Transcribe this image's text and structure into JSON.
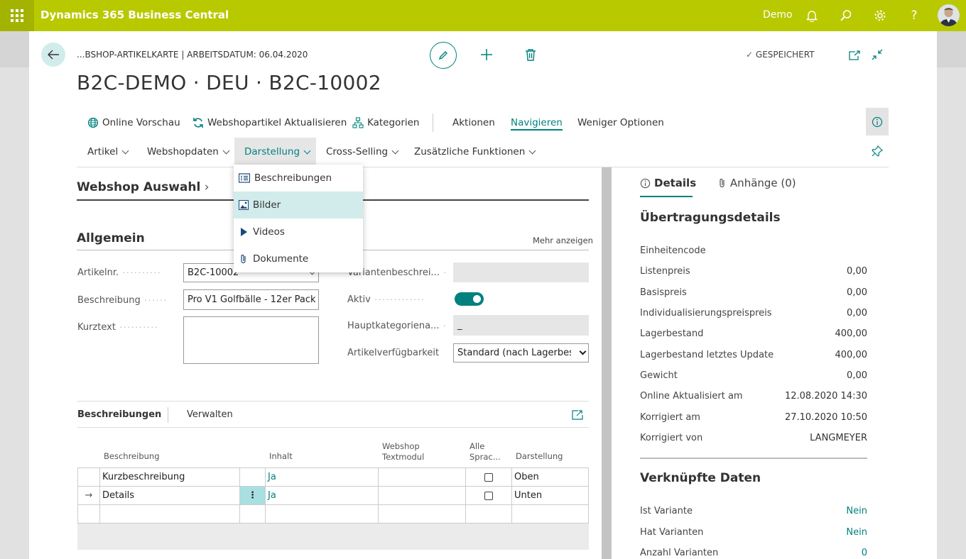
{
  "app": {
    "title": "Dynamics 365 Business Central",
    "company": "Demo"
  },
  "header": {
    "breadcrumb": "...BSHOP-ARTIKELKARTE | ARBEITSDATUM: 06.04.2020",
    "title": "B2C-DEMO · DEU · B2C-10002",
    "status": "GESPEICHERT"
  },
  "actions": {
    "online_preview": "Online Vorschau",
    "update": "Webshopartikel Aktualisieren",
    "categories": "Kategorien",
    "aktionen": "Aktionen",
    "navigieren": "Navigieren",
    "fewer": "Weniger Optionen"
  },
  "submenu": {
    "artikel": "Artikel",
    "webshopdaten": "Webshopdaten",
    "darstellung": "Darstellung",
    "cross": "Cross-Selling",
    "extra": "Zusätzliche Funktionen"
  },
  "dropdown": [
    "Beschreibungen",
    "Bilder",
    "Videos",
    "Dokumente"
  ],
  "sections": {
    "webshop": "Webshop Auswahl",
    "allgemein": "Allgemein",
    "mehr": "Mehr anzeigen"
  },
  "form": {
    "artikelnr_label": "Artikelnr.",
    "artikelnr": "B2C-10002",
    "beschreibung_label": "Beschreibung",
    "beschreibung": "Pro V1 Golfbälle - 12er Pack",
    "kurztext_label": "Kurztext",
    "variant_label": "Variantenbeschrei...",
    "aktiv_label": "Aktiv",
    "aktiv": true,
    "hauptkat_label": "Hauptkategoriena...",
    "hauptkat": "_",
    "verf_label": "Artikelverfügbarkeit",
    "verf": "Standard (nach Lagerbestand)"
  },
  "lines": {
    "tab1": "Beschreibungen",
    "tab2": "Verwalten",
    "headers": [
      "Beschreibung",
      "Inhalt",
      "Webshop Textmodul",
      "Alle Sprac...",
      "Darstellung"
    ],
    "rows": [
      {
        "beschreibung": "Kurzbeschreibung",
        "inhalt": "Ja",
        "darstellung": "Oben"
      },
      {
        "beschreibung": "Details",
        "inhalt": "Ja",
        "darstellung": "Unten"
      }
    ]
  },
  "factbox": {
    "tab_details": "Details",
    "tab_attach": "Anhänge (0)",
    "section1": "Übertragungsdetails",
    "rows": [
      {
        "label": "Einheitencode",
        "value": ""
      },
      {
        "label": "Listenpreis",
        "value": "0,00"
      },
      {
        "label": "Basispreis",
        "value": "0,00"
      },
      {
        "label": "Individualisierungspreispreis",
        "value": "0,00"
      },
      {
        "label": "Lagerbestand",
        "value": "400,00"
      },
      {
        "label": "Lagerbestand letztes Update",
        "value": "400,00"
      },
      {
        "label": "Gewicht",
        "value": "0,00"
      },
      {
        "label": "Online Aktualisiert am",
        "value": "12.08.2020 14:30"
      },
      {
        "label": "Korrigiert am",
        "value": "27.10.2020 10:50"
      },
      {
        "label": "Korrigiert von",
        "value": "LANGMEYER"
      }
    ],
    "section2": "Verknüpfte Daten",
    "rows2": [
      {
        "label": "Ist Variante",
        "value": "Nein"
      },
      {
        "label": "Hat Varianten",
        "value": "Nein"
      },
      {
        "label": "Anzahl Varianten",
        "value": "0"
      }
    ]
  },
  "colors": {
    "brand": "#b8c900",
    "accent": "#00817e"
  }
}
